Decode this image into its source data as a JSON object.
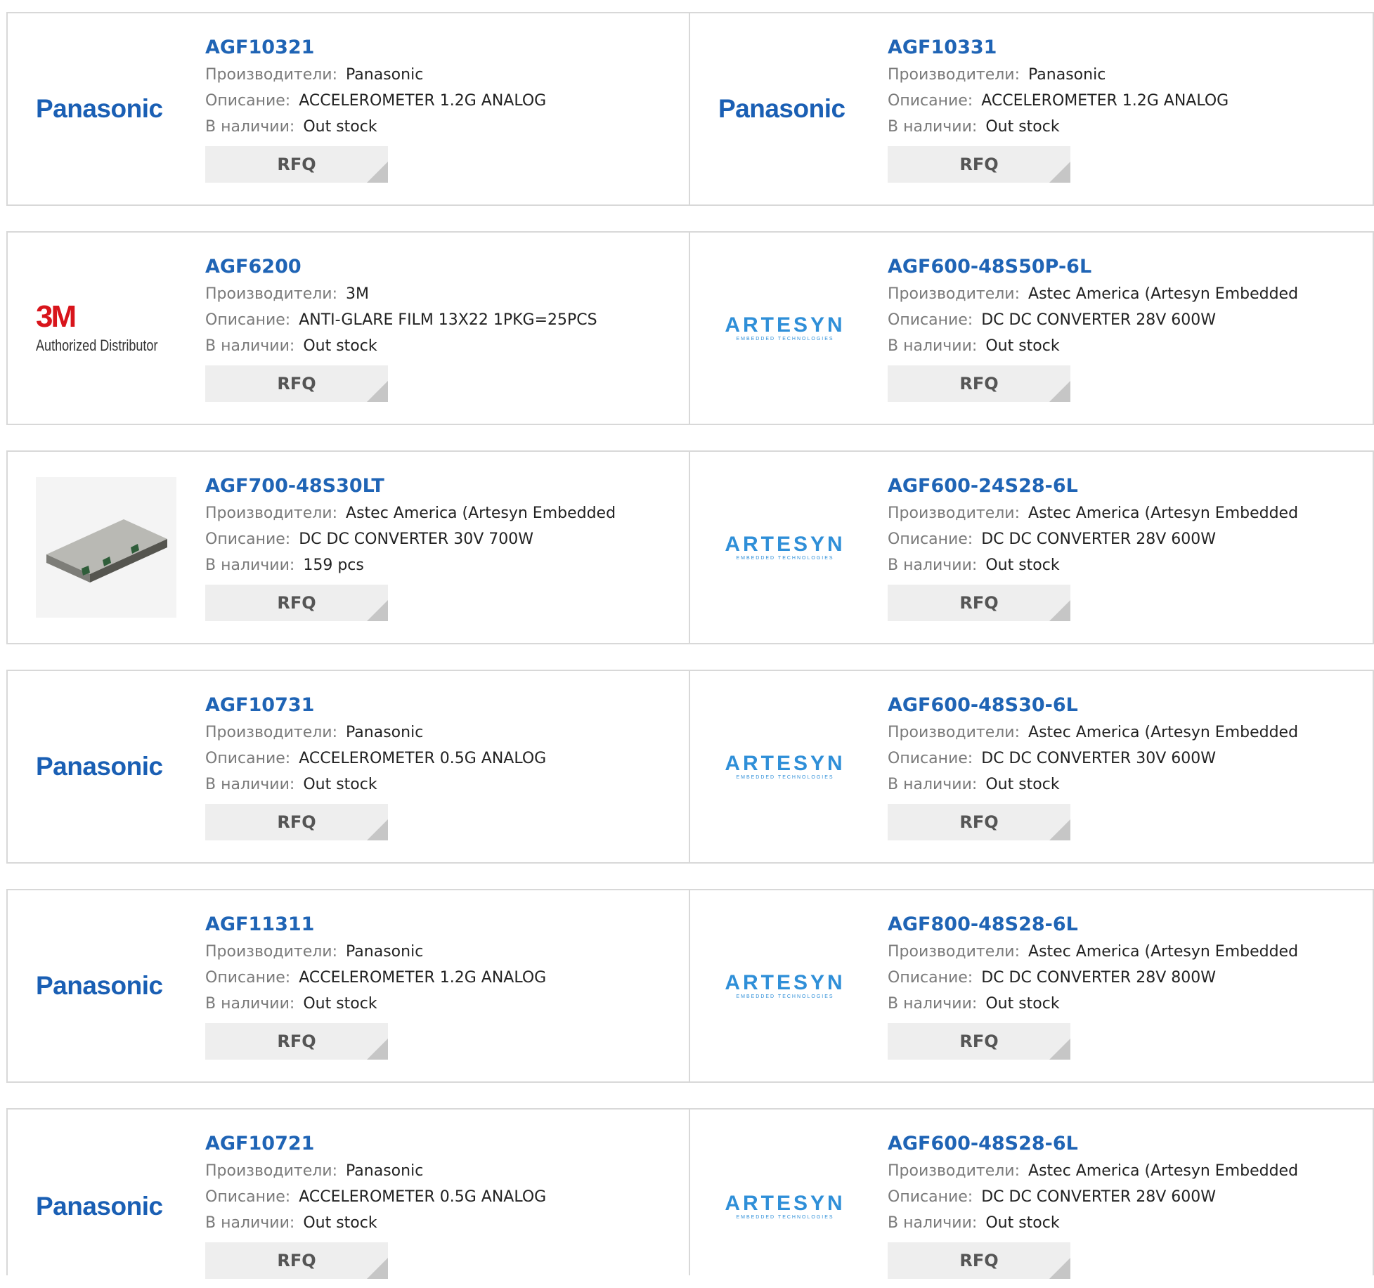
{
  "labels": {
    "manufacturer": "Производители:",
    "description": "Описание:",
    "stock": "В наличии:",
    "rfq": "RFQ"
  },
  "products": [
    {
      "part": "AGF10321",
      "manufacturer": "Panasonic",
      "description": "ACCELEROMETER 1.2G ANALOG",
      "stock": "Out stock",
      "logo": "Panasonic"
    },
    {
      "part": "AGF10331",
      "manufacturer": "Panasonic",
      "description": "ACCELEROMETER 1.2G ANALOG",
      "stock": "Out stock",
      "logo": "Panasonic"
    },
    {
      "part": "AGF6200",
      "manufacturer": "3M",
      "description": "ANTI-GLARE FILM 13X22 1PKG=25PCS",
      "stock": "Out stock",
      "logo": "3M",
      "logo_sub": "Authorized Distributor"
    },
    {
      "part": "AGF600-48S50P-6L",
      "manufacturer": "Astec America (Artesyn Embedded",
      "description": "DC DC CONVERTER 28V 600W",
      "stock": "Out stock",
      "logo": "ARTESYN",
      "logo_sub": "EMBEDDED TECHNOLOGIES"
    },
    {
      "part": "AGF700-48S30LT",
      "manufacturer": "Astec America (Artesyn Embedded",
      "description": "DC DC CONVERTER 30V 700W",
      "stock": "159 pcs",
      "logo": "photo"
    },
    {
      "part": "AGF600-24S28-6L",
      "manufacturer": "Astec America (Artesyn Embedded",
      "description": "DC DC CONVERTER 28V 600W",
      "stock": "Out stock",
      "logo": "ARTESYN",
      "logo_sub": "EMBEDDED TECHNOLOGIES"
    },
    {
      "part": "AGF10731",
      "manufacturer": "Panasonic",
      "description": "ACCELEROMETER 0.5G ANALOG",
      "stock": "Out stock",
      "logo": "Panasonic"
    },
    {
      "part": "AGF600-48S30-6L",
      "manufacturer": "Astec America (Artesyn Embedded",
      "description": "DC DC CONVERTER 30V 600W",
      "stock": "Out stock",
      "logo": "ARTESYN",
      "logo_sub": "EMBEDDED TECHNOLOGIES"
    },
    {
      "part": "AGF11311",
      "manufacturer": "Panasonic",
      "description": "ACCELEROMETER 1.2G ANALOG",
      "stock": "Out stock",
      "logo": "Panasonic"
    },
    {
      "part": "AGF800-48S28-6L",
      "manufacturer": "Astec America (Artesyn Embedded",
      "description": "DC DC CONVERTER 28V 800W",
      "stock": "Out stock",
      "logo": "ARTESYN",
      "logo_sub": "EMBEDDED TECHNOLOGIES"
    },
    {
      "part": "AGF10721",
      "manufacturer": "Panasonic",
      "description": "ACCELEROMETER 0.5G ANALOG",
      "stock": "Out stock",
      "logo": "Panasonic"
    },
    {
      "part": "AGF600-48S28-6L",
      "manufacturer": "Astec America (Artesyn Embedded",
      "description": "DC DC CONVERTER 28V 600W",
      "stock": "Out stock",
      "logo": "ARTESYN",
      "logo_sub": "EMBEDDED TECHNOLOGIES"
    }
  ]
}
